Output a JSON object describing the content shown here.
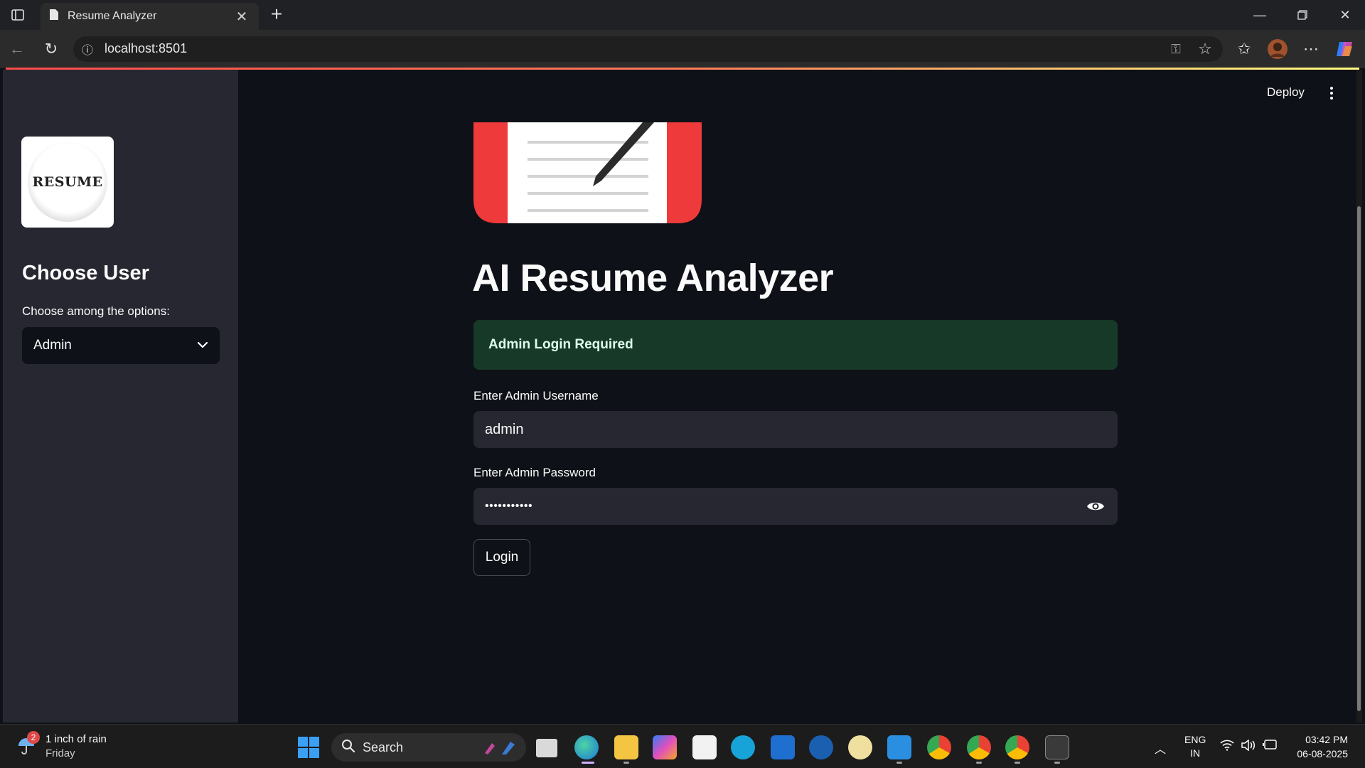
{
  "browser": {
    "tab_title": "Resume Analyzer",
    "url": "localhost:8501"
  },
  "sidebar": {
    "logo_text": "RESUME",
    "title": "Choose User",
    "select_label": "Choose among the options:",
    "select_value": "Admin"
  },
  "header": {
    "deploy_label": "Deploy"
  },
  "main": {
    "title": "AI Resume Analyzer",
    "alert": "Admin Login Required",
    "username_label": "Enter Admin Username",
    "username_value": "admin",
    "password_label": "Enter Admin Password",
    "password_value": "•••••••••••",
    "login_label": "Login"
  },
  "taskbar": {
    "weather_badge": "2",
    "weather_text": "1 inch of rain",
    "weather_day": "Friday",
    "search_label": "Search",
    "lang_line1": "ENG",
    "lang_line2": "IN",
    "time": "03:42 PM",
    "date": "06-08-2025"
  },
  "colors": {
    "accent": "#ff4b4b",
    "sidebar_bg": "#262730",
    "main_bg": "#0e1117",
    "success_bg": "#173928"
  }
}
